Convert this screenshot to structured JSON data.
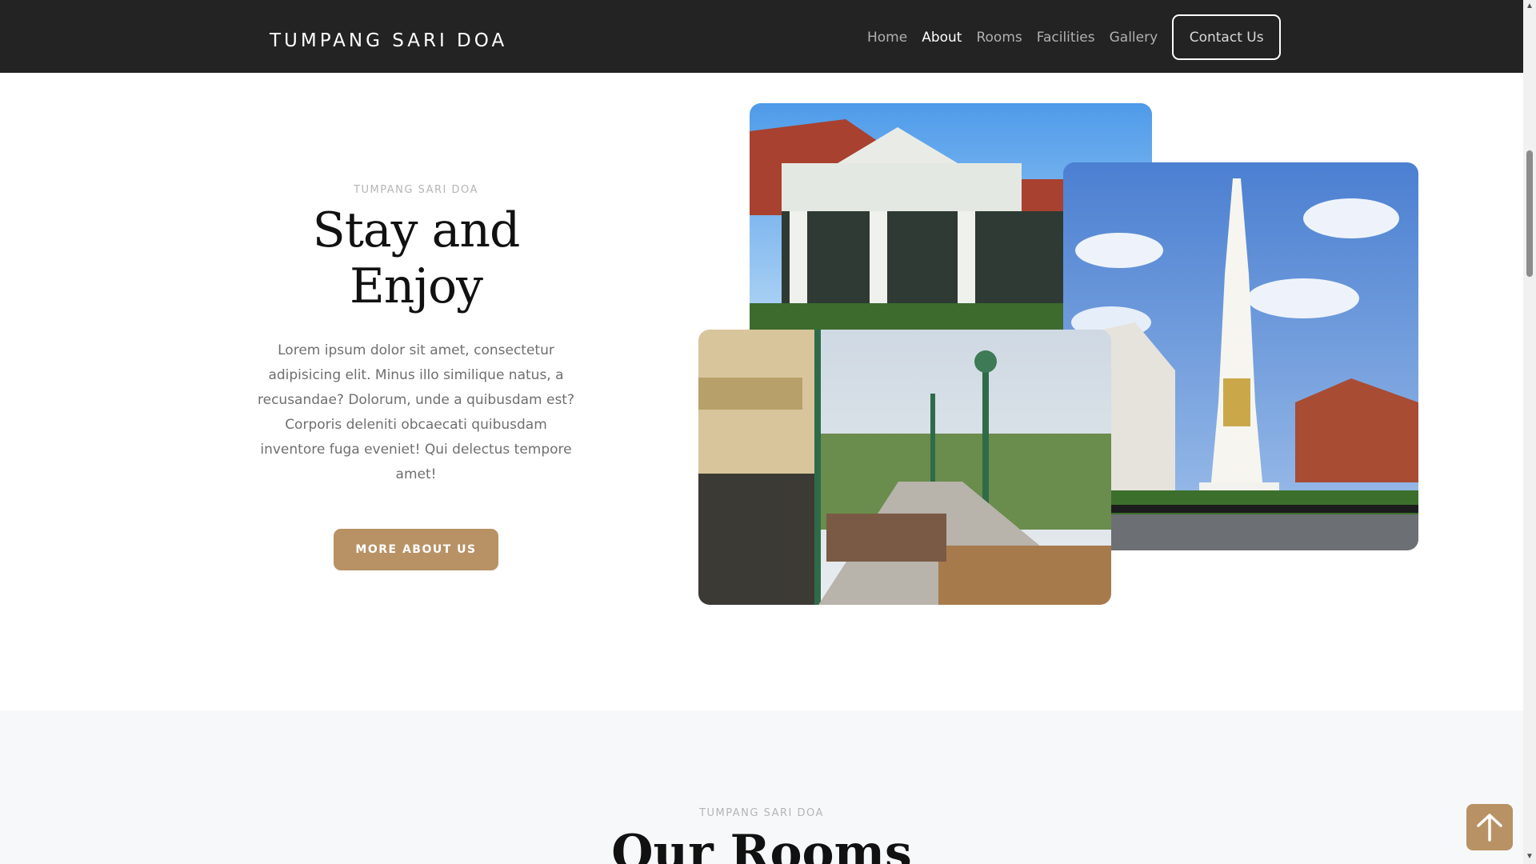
{
  "navbar": {
    "brand": "TUMPANG SARI DOA",
    "links": [
      {
        "label": "Home",
        "active": false
      },
      {
        "label": "About",
        "active": true
      },
      {
        "label": "Rooms",
        "active": false
      },
      {
        "label": "Facilities",
        "active": false
      },
      {
        "label": "Gallery",
        "active": false
      }
    ],
    "contact_label": "Contact Us"
  },
  "about": {
    "eyebrow": "TUMPANG SARI DOA",
    "title": "Stay and Enjoy",
    "description": "Lorem ipsum dolor sit amet, consectetur adipisicing elit. Minus illo similique natus, a recusandae? Dolorum, unde a quibusdam est? Corporis deleniti obcaecati quibusdam inventore fuga eveniet! Qui delectus tempore amet!",
    "button_label": "MORE ABOUT US",
    "images": [
      "kraton-gate-photo",
      "tugu-monument-photo",
      "malioboro-street-photo"
    ]
  },
  "rooms": {
    "eyebrow": "TUMPANG SARI DOA",
    "title": "Our Rooms"
  },
  "back_to_top_icon": "arrow-up-icon",
  "colors": {
    "navbar_bg": "#232323",
    "accent": "#b89265",
    "section_bg": "#f7f8fa"
  }
}
